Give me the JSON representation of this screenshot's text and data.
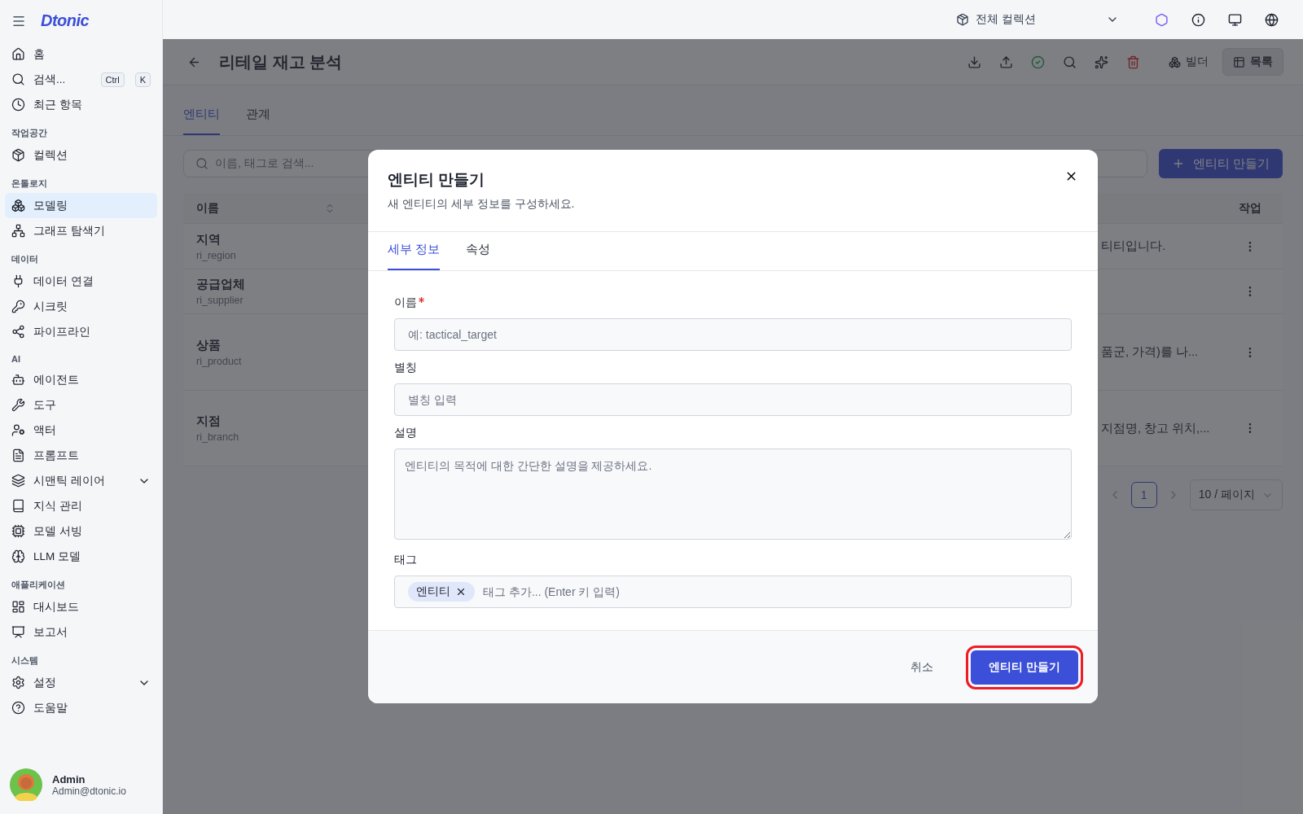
{
  "app": {
    "logo": "Dtonic"
  },
  "sidebar": {
    "groups": [
      {
        "items": [
          {
            "label": "홈",
            "selected": false
          },
          {
            "label": "검색...",
            "selected": false,
            "shortcut": [
              "Ctrl",
              "K"
            ]
          },
          {
            "label": "최근 항목",
            "selected": false
          }
        ]
      },
      {
        "title": "작업공간",
        "items": [
          {
            "label": "컬렉션",
            "selected": false
          }
        ]
      },
      {
        "title": "온톨로지",
        "items": [
          {
            "label": "모델링",
            "selected": true
          },
          {
            "label": "그래프 탐색기",
            "selected": false
          }
        ]
      },
      {
        "title": "데이터",
        "items": [
          {
            "label": "데이터 연결",
            "selected": false
          },
          {
            "label": "시크릿",
            "selected": false
          },
          {
            "label": "파이프라인",
            "selected": false
          }
        ]
      },
      {
        "title": "AI",
        "items": [
          {
            "label": "에이전트",
            "selected": false
          },
          {
            "label": "도구",
            "selected": false
          },
          {
            "label": "액터",
            "selected": false
          },
          {
            "label": "프롬프트",
            "selected": false
          },
          {
            "label": "시맨틱 레이어",
            "selected": false,
            "expanded": false
          },
          {
            "label": "지식 관리",
            "selected": false
          },
          {
            "label": "모델 서빙",
            "selected": false
          },
          {
            "label": "LLM 모델",
            "selected": false
          }
        ]
      },
      {
        "title": "애플리케이션",
        "items": [
          {
            "label": "대시보드",
            "selected": false
          },
          {
            "label": "보고서",
            "selected": false
          }
        ]
      },
      {
        "title": "시스템",
        "items": [
          {
            "label": "설정",
            "selected": false,
            "expanded": false
          },
          {
            "label": "도움말",
            "selected": false
          }
        ]
      }
    ]
  },
  "user": {
    "name": "Admin",
    "email": "Admin@dtonic.io"
  },
  "topbar": {
    "collection": "전체 컬렉션"
  },
  "page": {
    "title": "리테일 재고 분석",
    "view_toggle": [
      {
        "label": "빌더",
        "selected": false
      },
      {
        "label": "목록",
        "selected": true
      }
    ],
    "tabs": [
      {
        "label": "엔티티",
        "selected": true
      },
      {
        "label": "관계",
        "selected": false
      }
    ],
    "search": {
      "placeholder": "이름, 태그로 검색..."
    },
    "create_button": "엔티티 만들기"
  },
  "table": {
    "columns": [
      "이름",
      "작업"
    ],
    "rows": [
      {
        "name": "지역",
        "code": "ri_region",
        "description": "티티입니다."
      },
      {
        "name": "공급업체",
        "code": "ri_supplier",
        "description": ""
      },
      {
        "name": "상품",
        "code": "ri_product",
        "description": "품군, 가격)를 나..."
      },
      {
        "name": "지점",
        "code": "ri_branch",
        "description": "지점명, 창고 위치,..."
      }
    ],
    "pagination": {
      "page": "1",
      "per_page": "10 / 페이지"
    }
  },
  "modal": {
    "title": "엔티티 만들기",
    "subtitle": "새 엔티티의 세부 정보를 구성하세요.",
    "tabs": [
      {
        "label": "세부 정보",
        "selected": true
      },
      {
        "label": "속성",
        "selected": false
      }
    ],
    "fields": [
      {
        "kind": "input",
        "label": "이름",
        "required": true,
        "placeholder": "예: tactical_target"
      },
      {
        "kind": "input",
        "label": "별칭",
        "required": false,
        "placeholder": "별칭 입력"
      },
      {
        "kind": "textarea",
        "label": "설명",
        "required": false,
        "placeholder": "엔티티의 목적에 대한 간단한 설명을 제공하세요."
      },
      {
        "kind": "tags",
        "label": "태그",
        "required": false,
        "tags": [
          "엔티티"
        ],
        "placeholder": "태그 추가... (Enter 키 입력)"
      }
    ],
    "cancel": "취소",
    "submit": "엔티티 만들기",
    "submit_highlighted": true
  }
}
